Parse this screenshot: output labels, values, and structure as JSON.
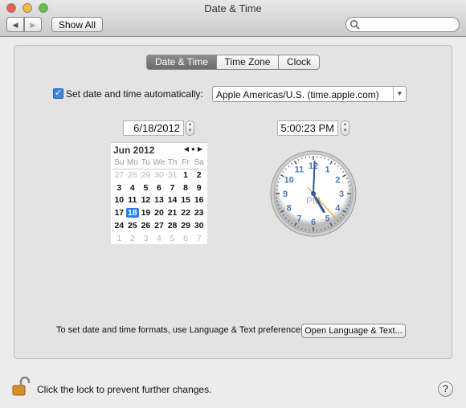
{
  "window": {
    "title": "Date & Time"
  },
  "toolbar": {
    "back": "◀",
    "forward": "▶",
    "show_all": "Show All",
    "search_placeholder": ""
  },
  "tabs": [
    {
      "label": "Date & Time",
      "selected": true
    },
    {
      "label": "Time Zone"
    },
    {
      "label": "Clock"
    }
  ],
  "auto": {
    "label": "Set date and time automatically:",
    "checked": true,
    "server": "Apple Americas/U.S. (time.apple.com)"
  },
  "date": {
    "value": "6/18/2012"
  },
  "time": {
    "value": "5:00:23 PM",
    "hour": 5,
    "minute": 0,
    "second": 23,
    "ampm": "PM"
  },
  "calendar": {
    "month": "Jun 2012",
    "weekdays": [
      "Su",
      "Mo",
      "Tu",
      "We",
      "Th",
      "Fr",
      "Sa"
    ],
    "weeks": [
      [
        "27",
        "28",
        "29",
        "30",
        "31",
        "1",
        "2"
      ],
      [
        "3",
        "4",
        "5",
        "6",
        "7",
        "8",
        "9"
      ],
      [
        "10",
        "11",
        "12",
        "13",
        "14",
        "15",
        "16"
      ],
      [
        "17",
        "18",
        "19",
        "20",
        "21",
        "22",
        "23"
      ],
      [
        "24",
        "25",
        "26",
        "27",
        "28",
        "29",
        "30"
      ],
      [
        "1",
        "2",
        "3",
        "4",
        "5",
        "6",
        "7"
      ]
    ],
    "selected": "18",
    "accent": "#2a7fe8"
  },
  "clock": {
    "numbers": [
      "12",
      "1",
      "2",
      "3",
      "4",
      "5",
      "6",
      "7",
      "8",
      "9",
      "10",
      "11"
    ],
    "ampm": "PM",
    "second_hand_color": "#f0a020",
    "hand_color": "#2b5a9a"
  },
  "footer": {
    "formats_text": "To set date and time formats, use Language & Text preferences.",
    "open_button": "Open Language & Text...",
    "lock_text": "Click the lock to prevent further changes.",
    "help": "?"
  }
}
